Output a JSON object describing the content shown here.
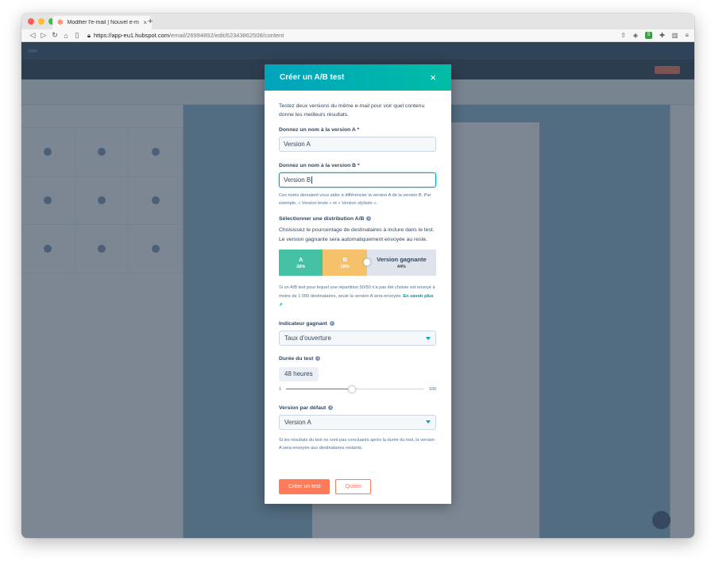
{
  "browser": {
    "tab_title": "Modifier l'e-mail | Nouvel e-ma...",
    "tab_favicon": "hubspot-sprocket-icon",
    "url_host": "https://app-eu1.hubspot.com",
    "url_path": "/email/26994892/edit/62343862508/content"
  },
  "modal": {
    "title": "Créer un A/B test",
    "close_icon": "×",
    "intro": "Testez deux versions du même e-mail pour voir quel contenu donne les meilleurs résultats.",
    "version_a": {
      "label": "Donnez un nom à la version A *",
      "value": "Version A"
    },
    "version_b": {
      "label": "Donnez un nom à la version B *",
      "value": "Version B"
    },
    "names_help": "Ces noms devraient vous aider à différencier la version A de la version B. Par exemple, « Version brute » et « Version stylisée ».",
    "distribution": {
      "label": "Sélectionner une distribution A/B",
      "description": "Choisissez le pourcentage de destinataires à inclure dans le test. Le version gagnante sera automatiquement envoyée au reste.",
      "segments": [
        {
          "label": "A",
          "percent": "28%",
          "fraction": 0.28,
          "color": "#45c2a4"
        },
        {
          "label": "B",
          "percent": "28%",
          "fraction": 0.28,
          "color": "#f5c26b"
        },
        {
          "label": "Version gagnante",
          "percent": "44%",
          "fraction": 0.44,
          "color": "#dfe3eb"
        }
      ],
      "note": "Si un A/B test pour lequel une répartition 50/50 n'a pas été choisie est envoyé à moins de 1 000 destinataires, seule la version A sera envoyée.",
      "learn_more": "En savoir plus"
    },
    "winning_metric": {
      "label": "Indicateur gagnant",
      "value": "Taux d'ouverture"
    },
    "test_duration": {
      "label": "Durée du test",
      "value": "48 heures",
      "slider_min": "1",
      "slider_max": "100",
      "slider_fraction": 0.48
    },
    "default_version": {
      "label": "Version par défaut",
      "value": "Version A",
      "help": "Si les résultats du test ne sont pas concluants après la durée du test, la version A sera envoyée aux destinataires restants."
    },
    "buttons": {
      "create": "Créer un test",
      "cancel": "Quitter"
    }
  },
  "colors": {
    "header_gradient_start": "#00a4bd",
    "header_gradient_end": "#00bda5",
    "primary_orange": "#ff7a59",
    "text": "#33475b"
  }
}
